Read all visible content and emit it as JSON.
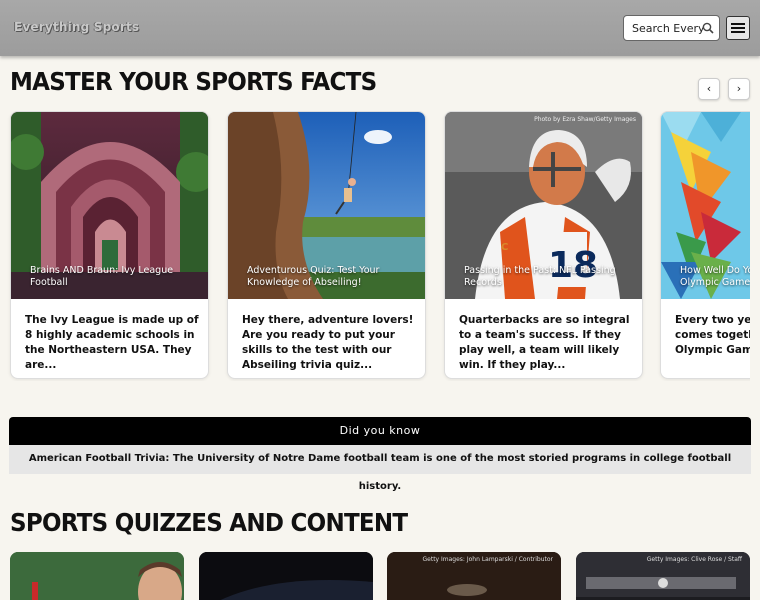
{
  "header": {
    "logo": "Everything Sports",
    "search_placeholder": "Search Everyt"
  },
  "facts_section": {
    "title": "MASTER YOUR SPORTS FACTS",
    "prev_label": "‹",
    "next_label": "›",
    "cards": [
      {
        "title": "Brains AND Braun: Ivy League Football",
        "description": "The Ivy League is made up of 8 highly academic schools in the Northeastern USA. They are...",
        "credit": ""
      },
      {
        "title": "Adventurous Quiz: Test Your Knowledge of Abseiling!",
        "description": "Hey there, adventure lovers! Are you ready to put your skills to the test with our Abseiling trivia quiz...",
        "credit": ""
      },
      {
        "title": "Passing in the Past: NFL Passing Records",
        "description": "Quarterbacks are so integral to a team's success. If they play well, a team will likely win. If they play...",
        "credit": "Photo by Ezra Shaw/Getty Images"
      },
      {
        "title": "How Well Do You Know the Olympic Games?",
        "description": "Every two years the world comes together to watch the Olympic Games! These i",
        "credit": ""
      }
    ]
  },
  "did_you_know": {
    "heading": "Did you know",
    "text": "American Football Trivia: The University of Notre Dame football team is one of the most storied programs in college football history."
  },
  "quizzes_section": {
    "title": "SPORTS QUIZZES AND CONTENT",
    "cards": [
      {
        "credit": ""
      },
      {
        "credit": ""
      },
      {
        "credit": "Getty Images: John Lamparski / Contributor"
      },
      {
        "credit": "Getty Images: Clive Rose / Staff"
      }
    ]
  }
}
